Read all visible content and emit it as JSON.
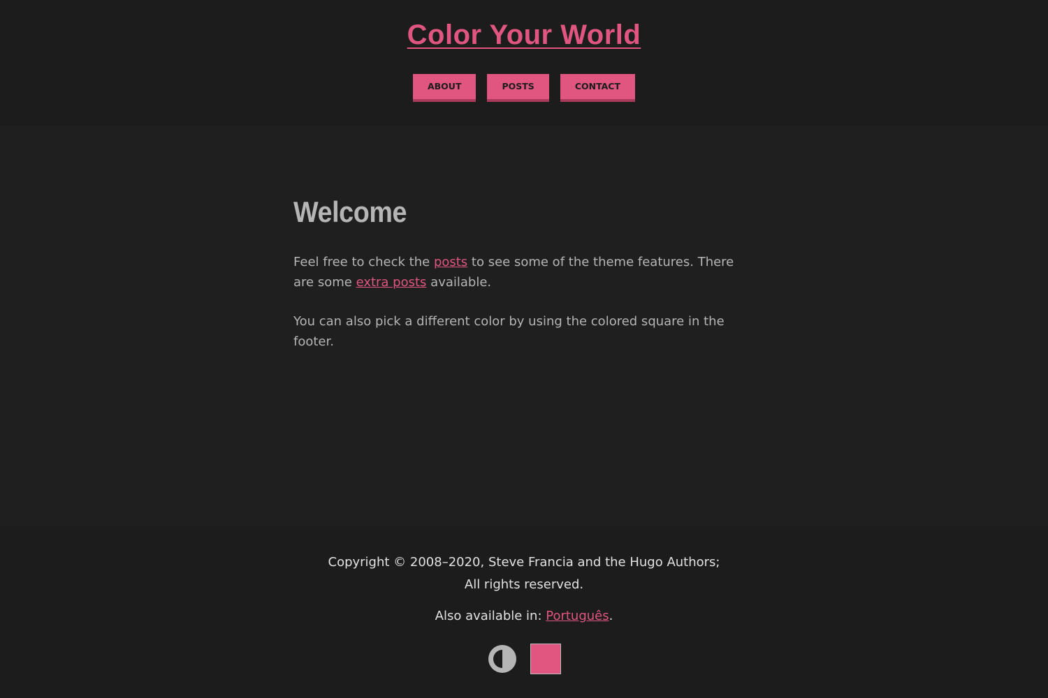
{
  "site": {
    "title": "Color Your World"
  },
  "nav": {
    "items": [
      {
        "label": "About"
      },
      {
        "label": "Posts"
      },
      {
        "label": "Contact"
      }
    ]
  },
  "page": {
    "heading": "Welcome",
    "para1": {
      "t1": "Feel free to check the ",
      "link1": "posts",
      "t2": " to see some of the theme features. There are some ",
      "link2": "extra posts",
      "t3": " available."
    },
    "para2": "You can also pick a different color by using the colored square in the footer."
  },
  "footer": {
    "copyright_line1": "Copyright © 2008–2020, Steve Francia and the Hugo Authors;",
    "copyright_line2": "All rights reserved.",
    "also_available": "Also available in: ",
    "language_link": "Português",
    "period": ".",
    "contrast_icon": "contrast-toggle-icon",
    "swatch_color": "#e05680"
  },
  "colors": {
    "accent": "#e05680",
    "background": "#1f1f1f",
    "header_background": "#1c1c1c",
    "text": "#b5b5b5"
  }
}
